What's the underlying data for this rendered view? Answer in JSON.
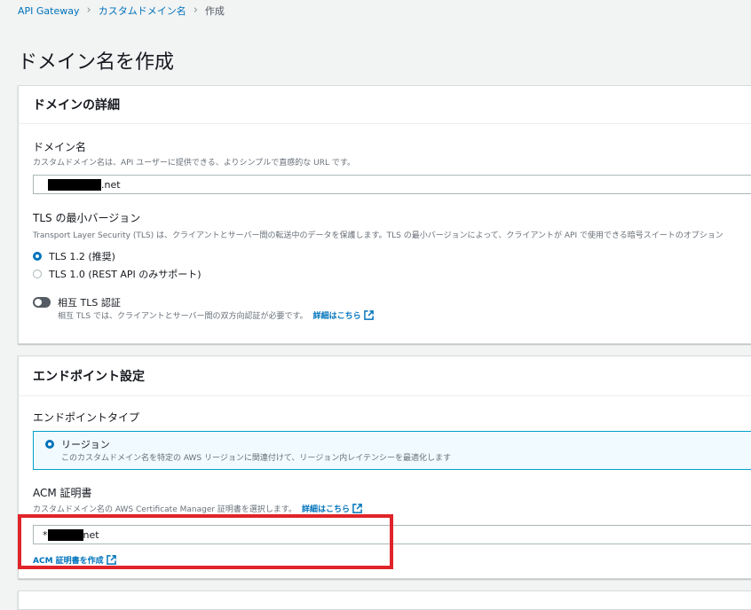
{
  "breadcrumb": {
    "items": [
      "API Gateway",
      "カスタムドメイン名"
    ],
    "current": "作成"
  },
  "page": {
    "title": "ドメイン名を作成"
  },
  "domain_details": {
    "header": "ドメインの詳細",
    "domain_name": {
      "label": "ドメイン名",
      "description": "カスタムドメイン名は、API ユーザーに提供できる、よりシンプルで直感的な URL です。",
      "value_suffix": ".net"
    },
    "tls": {
      "label": "TLS の最小バージョン",
      "description": "Transport Layer Security (TLS) は、クライアントとサーバー間の転送中のデータを保護します。TLS の最小バージョンによって、クライアントが API で使用できる暗号スイートのオプション",
      "options": [
        {
          "label": "TLS 1.2 (推奨)",
          "selected": true
        },
        {
          "label": "TLS 1.0 (REST API のみサポート)",
          "selected": false
        }
      ]
    },
    "mtls": {
      "label": "相互 TLS 認証",
      "description": "相互 TLS では、クライアントとサーバー間の双方向認証が必要です。",
      "link": "詳細はこちら",
      "enabled": false
    }
  },
  "endpoint": {
    "header": "エンドポイント設定",
    "type_label": "エンドポイントタイプ",
    "region": {
      "label": "リージョン",
      "description": "このカスタムドメイン名を特定の AWS リージョンに関連付けて、リージョン内レイテンシーを最適化します"
    },
    "acm": {
      "label": "ACM 証明書",
      "description": "カスタムドメイン名の AWS Certificate Manager 証明書を選択します。",
      "link": "詳細はこちら",
      "value_prefix": "*",
      "value_suffix": "net",
      "create_link": "ACM 証明書を作成"
    }
  },
  "colors": {
    "accent": "#0073bb",
    "highlight": "#e0242a",
    "tile_border": "#00a1c9"
  }
}
